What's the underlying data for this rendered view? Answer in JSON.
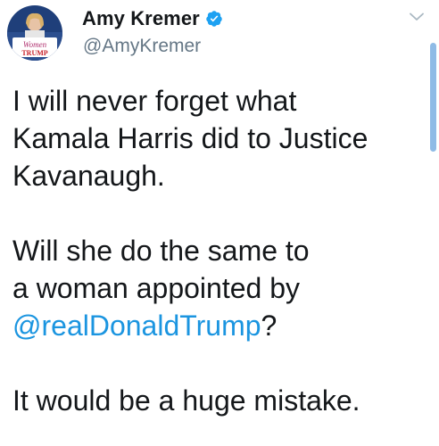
{
  "author": {
    "display_name": "Amy Kremer",
    "handle": "@AmyKremer",
    "verified": true,
    "avatar_text": "Women TRUMP"
  },
  "tweet": {
    "line1": "I will never forget what",
    "line2": "Kamala Harris did to Justice",
    "line3": "Kavanaugh.",
    "line4": "Will she do the same to",
    "line5": "a woman appointed by",
    "mention": "@realDonaldTrump",
    "mention_suffix": "?",
    "line7": "It would be a huge mistake."
  },
  "colors": {
    "link": "#1b95e0",
    "verified_badge": "#1da1f2",
    "handle_gray": "#657786"
  },
  "icons": {
    "verified": "verified-badge-icon",
    "menu": "chevron-down-icon"
  }
}
